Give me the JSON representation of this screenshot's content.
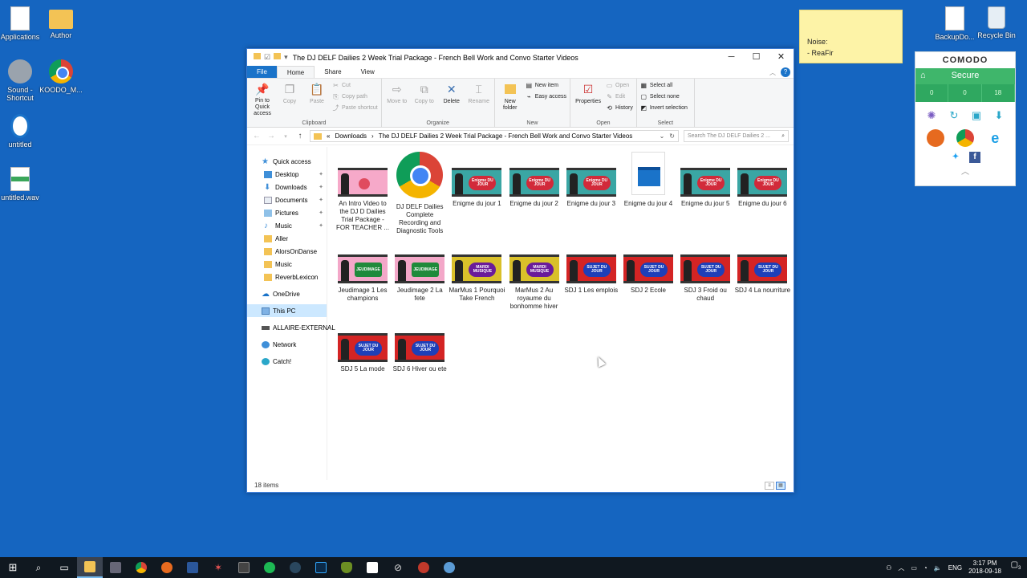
{
  "desktop": {
    "icons_left": [
      {
        "label": "Applications",
        "icon": "document-icon"
      },
      {
        "label": "Author",
        "icon": "folder-icon"
      },
      {
        "label": "Sound -\nShortcut",
        "icon": "speaker-icon"
      },
      {
        "label": "KOODO_M...",
        "icon": "chrome-icon"
      },
      {
        "label": "untitled",
        "icon": "audio-project-icon"
      },
      {
        "label": "untitled.wav",
        "icon": "wav-file-icon"
      }
    ],
    "icons_right": [
      {
        "label": "BackupDo...",
        "icon": "document-icon"
      },
      {
        "label": "Recycle Bin",
        "icon": "recycle-bin-icon"
      }
    ]
  },
  "sticky_note": {
    "line1": "Noise:",
    "line2": "- ReaFir"
  },
  "comodo": {
    "title": "COMODO",
    "status": "Secure",
    "stats": [
      "0",
      "0",
      "18"
    ],
    "accent": "#3fb66b"
  },
  "explorer": {
    "title": "The DJ DELF Dailies 2 Week Trial Package - French Bell Work and Convo Starter Videos",
    "tabs": {
      "file": "File",
      "home": "Home",
      "share": "Share",
      "view": "View"
    },
    "ribbon": {
      "clipboard": {
        "label": "Clipboard",
        "pin": "Pin to Quick access",
        "copy": "Copy",
        "paste": "Paste",
        "cut": "Cut",
        "copy_path": "Copy path",
        "paste_shortcut": "Paste shortcut"
      },
      "organize": {
        "label": "Organize",
        "move_to": "Move to",
        "copy_to": "Copy to",
        "delete": "Delete",
        "rename": "Rename"
      },
      "new": {
        "label": "New",
        "new_folder": "New folder",
        "new_item": "New item",
        "easy_access": "Easy access"
      },
      "open": {
        "label": "Open",
        "properties": "Properties",
        "open": "Open",
        "edit": "Edit",
        "history": "History"
      },
      "select": {
        "label": "Select",
        "select_all": "Select all",
        "select_none": "Select none",
        "invert": "Invert selection"
      }
    },
    "address": {
      "prefix": "«",
      "crumb1": "Downloads",
      "crumb2": "The DJ DELF Dailies 2 Week Trial Package - French Bell Work and Convo Starter Videos"
    },
    "search_placeholder": "Search The DJ DELF Dailies 2 ...",
    "nav": {
      "quick_access": "Quick access",
      "desktop": "Desktop",
      "downloads": "Downloads",
      "documents": "Documents",
      "pictures": "Pictures",
      "music": "Music",
      "aller": "Aller",
      "alorsondanse": "AlorsOnDanse",
      "music2": "Music",
      "reverblexicon": "ReverbLexicon",
      "onedrive": "OneDrive",
      "thispc": "This PC",
      "external": "ALLAIRE-EXTERNAL",
      "network": "Network",
      "catch": "Catch!"
    },
    "files": [
      {
        "name": "An Intro Video to the DJ D Dailies Trial Package - FOR TEACHER ...",
        "kind": "intro",
        "badge": ""
      },
      {
        "name": "DJ DELF Dailies Complete Recording and Diagnostic Tools",
        "kind": "chrome",
        "badge": ""
      },
      {
        "name": "Enigme du jour 1",
        "kind": "enigme",
        "badge": "Enigme DU JOUR"
      },
      {
        "name": "Enigme du jour 2",
        "kind": "enigme",
        "badge": "Enigme DU JOUR"
      },
      {
        "name": "Enigme du jour 3",
        "kind": "enigme",
        "badge": "Enigme DU JOUR"
      },
      {
        "name": "Enigme du jour 4",
        "kind": "clapper",
        "badge": ""
      },
      {
        "name": "Enigme du jour 5",
        "kind": "enigme",
        "badge": "Enigme DU JOUR"
      },
      {
        "name": "Enigme du jour 6",
        "kind": "enigme",
        "badge": "Enigme DU JOUR"
      },
      {
        "name": "Jeudimage 1 Les champions",
        "kind": "jeud",
        "badge": "JEUDIMAGE"
      },
      {
        "name": "Jeudimage 2 La fete",
        "kind": "jeud",
        "badge": "JEUDIMAGE"
      },
      {
        "name": "MarMus 1 Pourquoi Take French",
        "kind": "mardi",
        "badge": "MARDI MUSIQUE"
      },
      {
        "name": "MarMus 2 Au royaume du bonhomme hiver",
        "kind": "mardi",
        "badge": "MARDI MUSIQUE"
      },
      {
        "name": "SDJ 1 Les emplois",
        "kind": "sujet",
        "badge": "SUJET DU JOUR"
      },
      {
        "name": "SDJ 2 Ecole",
        "kind": "sujet",
        "badge": "SUJET DU JOUR"
      },
      {
        "name": "SDJ 3 Froid ou chaud",
        "kind": "sujet",
        "badge": "SUJET DU JOUR"
      },
      {
        "name": "SDJ 4 La nourriture",
        "kind": "sujet",
        "badge": "SUJET DU JOUR"
      },
      {
        "name": "SDJ 5 La mode",
        "kind": "sujet",
        "badge": "SUJET DU JOUR"
      },
      {
        "name": "SDJ 6 Hiver ou ete",
        "kind": "sujet",
        "badge": "SUJET DU JOUR"
      }
    ],
    "status": "18 items"
  },
  "taskbar": {
    "lang": "ENG",
    "time": "3:17 PM",
    "date": "2018-09-18",
    "notifications": "3"
  }
}
